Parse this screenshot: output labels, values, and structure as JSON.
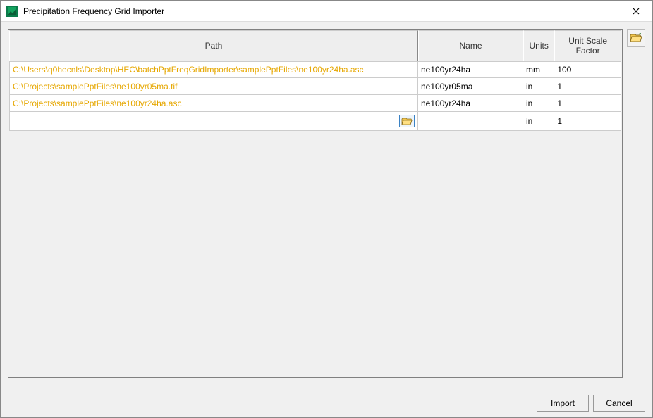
{
  "window": {
    "title": "Precipitation Frequency Grid Importer"
  },
  "table": {
    "headers": {
      "path": "Path",
      "name": "Name",
      "units": "Units",
      "factor": "Unit Scale Factor"
    },
    "rows": [
      {
        "path": "C:\\Users\\q0hecnls\\Desktop\\HEC\\batchPptFreqGridImporter\\samplePptFiles\\ne100yr24ha.asc",
        "name": "ne100yr24ha",
        "units": "mm",
        "factor": "100"
      },
      {
        "path": "C:\\Projects\\samplePptFiles\\ne100yr05ma.tif",
        "name": "ne100yr05ma",
        "units": "in",
        "factor": "1"
      },
      {
        "path": "C:\\Projects\\samplePptFiles\\ne100yr24ha.asc",
        "name": "ne100yr24ha",
        "units": "in",
        "factor": "1"
      },
      {
        "path": "",
        "name": "",
        "units": "in",
        "factor": "1"
      }
    ]
  },
  "buttons": {
    "import": "Import",
    "cancel": "Cancel"
  }
}
